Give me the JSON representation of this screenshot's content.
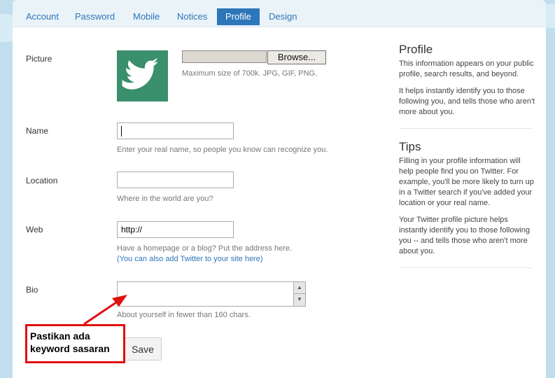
{
  "tabs": [
    {
      "label": "Account"
    },
    {
      "label": "Password"
    },
    {
      "label": "Mobile"
    },
    {
      "label": "Notices"
    },
    {
      "label": "Profile"
    },
    {
      "label": "Design"
    }
  ],
  "active_tab": "Profile",
  "form": {
    "picture": {
      "label": "Picture",
      "browse_label": "Browse...",
      "hint": "Maximum size of 700k. JPG, GIF, PNG.",
      "avatar_icon": "twitter-bird-icon"
    },
    "name": {
      "label": "Name",
      "value": "",
      "hint": "Enter your real name, so people you know can recognize you."
    },
    "location": {
      "label": "Location",
      "value": "",
      "hint": "Where in the world are you?"
    },
    "web": {
      "label": "Web",
      "value": "http://",
      "hint": "Have a homepage or a blog? Put the address here.",
      "link": "(You can also add Twitter to your site here)"
    },
    "bio": {
      "label": "Bio",
      "value": "",
      "hint": "About yourself in fewer than 160 chars."
    },
    "save_label": "Save"
  },
  "sidebar": {
    "profile": {
      "title": "Profile",
      "p1": "This information appears on your public profile, search results, and beyond.",
      "p2": "It helps instantly identify you to those following you, and tells those who aren't more about you."
    },
    "tips": {
      "title": "Tips",
      "p1": "Filling in your profile information will help people find you on Twitter. For example, you'll be more likely to turn up in a Twitter search if you've added your location or your real name.",
      "p2": "Your Twitter profile picture helps instantly identify you to those following you -- and tells those who aren't more about you."
    }
  },
  "annotation": {
    "line1": "Pastikan ada",
    "line2": "keyword sasaran"
  },
  "colors": {
    "background": "#c0deed",
    "accent": "#2d76b9",
    "avatar": "#3a8f6c",
    "annotation_border": "#e01010"
  }
}
